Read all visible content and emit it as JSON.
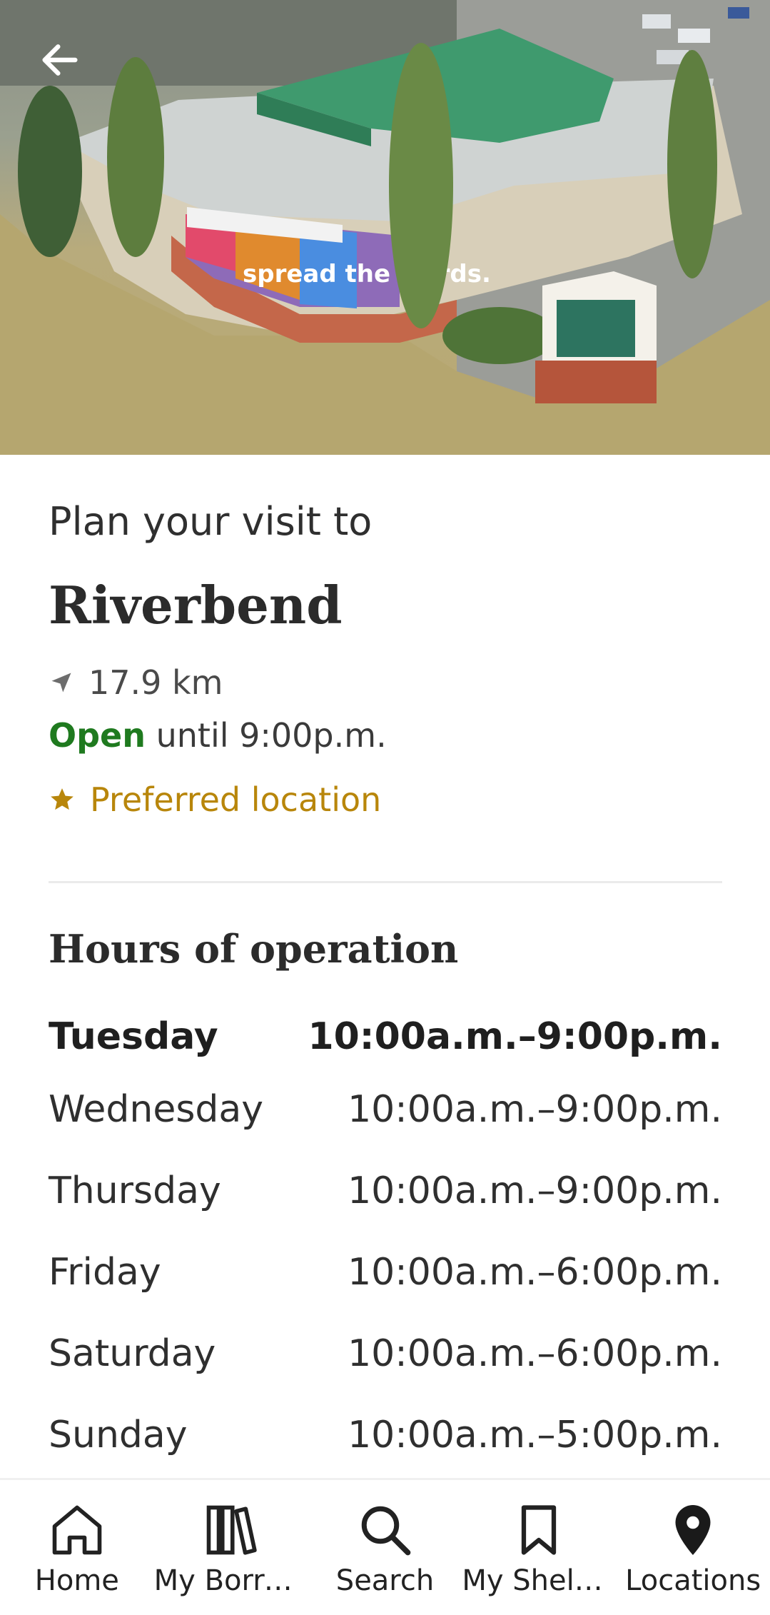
{
  "hero": {
    "back_icon": "arrow-left-icon",
    "signage_text": "spread the words."
  },
  "visit": {
    "subtitle": "Plan your visit to",
    "branch_name": "Riverbend",
    "distance": "17.9 km",
    "open_status": "Open",
    "open_until": " until 9:00p.m.",
    "preferred_label": "Preferred location",
    "status_color": "#1f7a1f",
    "preferred_color": "#b8860b"
  },
  "hours": {
    "heading": "Hours of operation",
    "rows": [
      {
        "day": "Tuesday",
        "time": "10:00a.m.–9:00p.m."
      },
      {
        "day": "Wednesday",
        "time": "10:00a.m.–9:00p.m."
      },
      {
        "day": "Thursday",
        "time": "10:00a.m.–9:00p.m."
      },
      {
        "day": "Friday",
        "time": "10:00a.m.–6:00p.m."
      },
      {
        "day": "Saturday",
        "time": "10:00a.m.–6:00p.m."
      },
      {
        "day": "Sunday",
        "time": "10:00a.m.–5:00p.m."
      }
    ]
  },
  "nav": {
    "items": [
      {
        "label": "Home",
        "icon": "home-icon"
      },
      {
        "label": "My Borro…",
        "icon": "books-icon"
      },
      {
        "label": "Search",
        "icon": "search-icon"
      },
      {
        "label": "My Shelves",
        "icon": "bookmark-icon"
      },
      {
        "label": "Locations",
        "icon": "location-pin-icon"
      }
    ]
  }
}
